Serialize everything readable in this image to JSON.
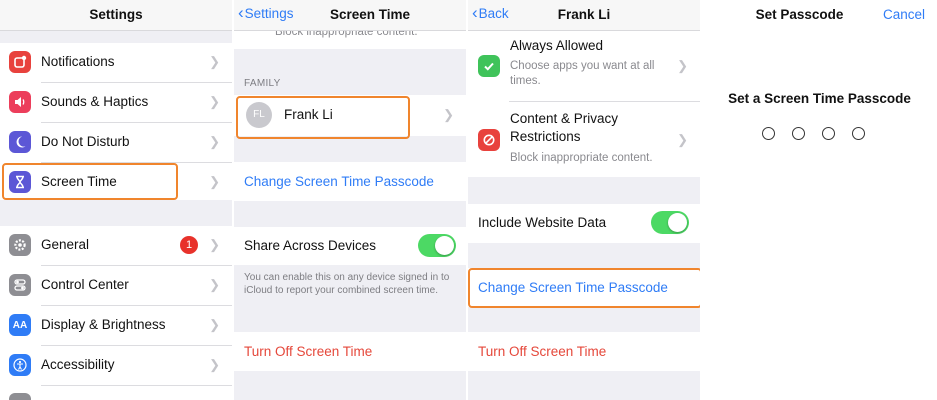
{
  "colors": {
    "accent": "#2f7cf6",
    "destructive": "#e5473a",
    "highlight": "#f0852d",
    "toggle_on": "#4cd964"
  },
  "panel1": {
    "title": "Settings",
    "items": [
      {
        "label": "Notifications",
        "icon": "notifications-icon",
        "color": "#e8423d"
      },
      {
        "label": "Sounds & Haptics",
        "icon": "speaker-icon",
        "color": "#ec3e5b"
      },
      {
        "label": "Do Not Disturb",
        "icon": "moon-icon",
        "color": "#5c57d6"
      },
      {
        "label": "Screen Time",
        "icon": "hourglass-icon",
        "color": "#5c57d6"
      },
      {
        "label": "General",
        "icon": "gear-icon",
        "color": "#8e8e93",
        "badge": "1"
      },
      {
        "label": "Control Center",
        "icon": "toggles-icon",
        "color": "#8e8e93"
      },
      {
        "label": "Display & Brightness",
        "icon": "text-size-icon",
        "color": "#2f7cf6"
      },
      {
        "label": "Accessibility",
        "icon": "accessibility-icon",
        "color": "#2f7cf6"
      }
    ]
  },
  "panel2": {
    "back": "Settings",
    "title": "Screen Time",
    "top_cut_text": "Block inappropriate content.",
    "family_header": "FAMILY",
    "member": {
      "initials": "FL",
      "name": "Frank Li"
    },
    "change_passcode": "Change Screen Time Passcode",
    "share_label": "Share Across Devices",
    "share_footnote": "You can enable this on any device signed in to iCloud to report your combined screen time.",
    "turn_off": "Turn Off Screen Time"
  },
  "panel3": {
    "back": "Back",
    "title": "Frank Li",
    "always_allowed_title": "Always Allowed",
    "always_allowed_sub": "Choose apps you want at all times.",
    "content_privacy_title": "Content & Privacy Restrictions",
    "content_privacy_sub": "Block inappropriate content.",
    "include_web": "Include Website Data",
    "change_passcode": "Change Screen Time Passcode",
    "turn_off": "Turn Off Screen Time"
  },
  "panel4": {
    "title": "Set Passcode",
    "cancel": "Cancel",
    "prompt": "Set a Screen Time Passcode",
    "digits": 4
  }
}
